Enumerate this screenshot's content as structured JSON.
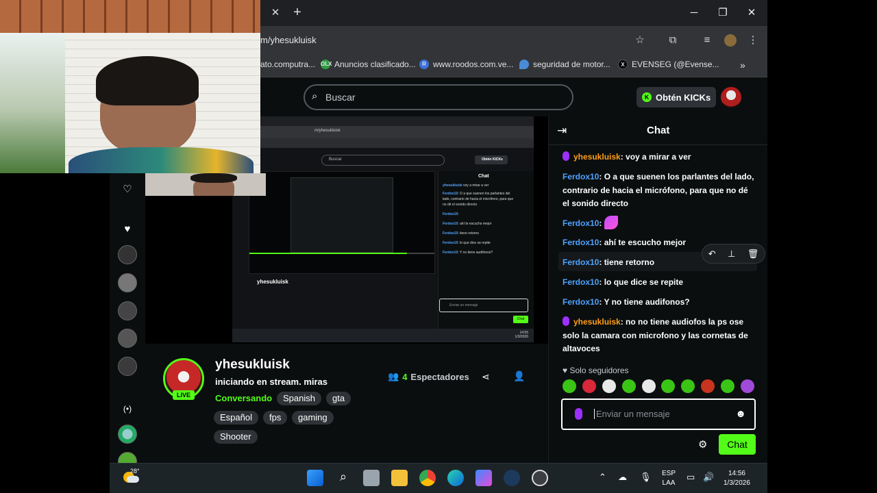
{
  "browser": {
    "url": "m/yhesukluisk",
    "bookmarks": [
      {
        "label": "ato.computra...",
        "icon_color": "#999999"
      },
      {
        "label": "Anuncios clasificado...",
        "icon_color": "#2e9e44",
        "icon_text": "OLX"
      },
      {
        "label": "www.roodos.com.ve...",
        "icon_color": "#3b6fd8",
        "icon_text": "R"
      },
      {
        "label": "seguridad de motor...",
        "icon_color": "#4a8bd8"
      },
      {
        "label": "EVENSEG (@Evense...",
        "icon_color": "#000000",
        "icon_text": "X"
      }
    ]
  },
  "header": {
    "search_placeholder": "Buscar",
    "kicks_button": "Obtén KICKs"
  },
  "stream": {
    "streamer": "yhesukluisk",
    "title": "iniciando en stream. miras",
    "category": "Conversando",
    "live_label": "LIVE",
    "viewer_count": "4",
    "viewer_label": "Espectadores",
    "tags_row1": [
      "Spanish",
      "gta"
    ],
    "tags_row2": [
      "Español",
      "fps",
      "gaming"
    ],
    "tags_row3": [
      "Shooter"
    ]
  },
  "chat": {
    "title": "Chat",
    "messages": [
      {
        "user": "yhesukluisk",
        "text": ": voy a mirar a ver",
        "role": "streamer"
      },
      {
        "user": "Ferdox10",
        "text": ": O a que suenen los parlantes del lado, contrario de hacia el micrófono, para que no dé el sonido directo ",
        "role": "viewer"
      },
      {
        "user": "Ferdox10",
        "text": ":",
        "role": "viewer",
        "emote": true
      },
      {
        "user": "Ferdox10",
        "text": ": ahí te escucho mejor ",
        "role": "viewer"
      },
      {
        "user": "Ferdox10",
        "text": ": tiene retorno ",
        "role": "viewer"
      },
      {
        "user": "Ferdox10",
        "text": ": lo que dice se repite ",
        "role": "viewer"
      },
      {
        "user": "Ferdox10",
        "text": ": Y no tiene audifonos? ",
        "role": "viewer"
      },
      {
        "user": "yhesukluisk",
        "text": ": no no tiene audiofos la ps ose solo la camara con microfono y las cornetas de altavoces",
        "role": "streamer"
      }
    ],
    "followers_only": "Solo seguidores",
    "input_placeholder": "Enviar un mensaje",
    "send_label": "Chat"
  },
  "nested_preview": {
    "url": "m/yhesukluisk",
    "search": "Buscar",
    "kicks": "Obtén KICKs",
    "chat_title": "Chat",
    "streamer": "yhesukluisk",
    "input": "Enviar un mensaje",
    "send": "Chat",
    "clock_time": "14:55",
    "clock_date": "1/3/2026",
    "lines": [
      {
        "user": "yhesukluisk",
        "text": " voy a mirar a ver"
      },
      {
        "user": "Ferdox10",
        "text": ": O a que suenen los parlantes del"
      },
      {
        "user": "",
        "text": "lado, contrario de hacia el micrófono, para que"
      },
      {
        "user": "",
        "text": "no dé el sonido directo"
      },
      {
        "user": "Ferdox10",
        "text": ":"
      },
      {
        "user": "Ferdox10",
        "text": ": ahí te escucho mejor"
      },
      {
        "user": "Ferdox10",
        "text": ": tiene retorno"
      },
      {
        "user": "Ferdox10",
        "text": ": lo que dice se repite"
      },
      {
        "user": "Ferdox10",
        "text": ": Y no tiene audifonos?"
      }
    ]
  },
  "taskbar": {
    "temperature": "28°",
    "lang_line1": "ESP",
    "lang_line2": "LAA",
    "time": "14:56",
    "date": "1/3/2026"
  },
  "colors": {
    "kick_green": "#53fc18",
    "username_blue": "#4ea3ff",
    "username_orange": "#ff9f1a",
    "mic_purple": "#9b30ff"
  }
}
